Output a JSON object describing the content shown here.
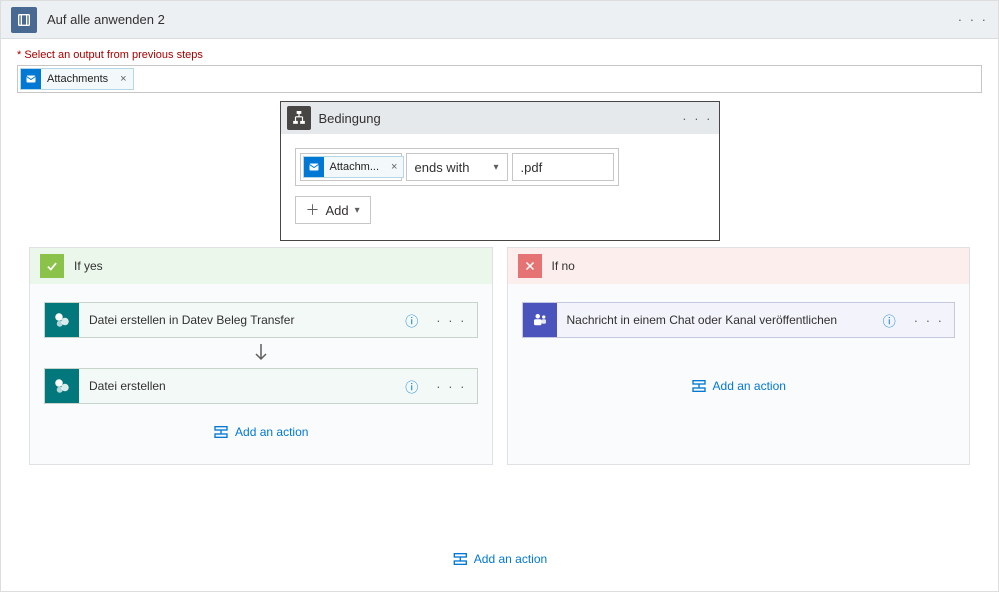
{
  "loop": {
    "title": "Auf alle anwenden 2"
  },
  "select_output": {
    "label": "Select an output from previous steps",
    "chip_text": "Attachments"
  },
  "condition": {
    "title": "Bedingung",
    "value1_chip": "Attachm...",
    "operator": "ends with",
    "value2": ".pdf",
    "add_label": "Add"
  },
  "branches": {
    "yes": {
      "label": "If yes",
      "actions": [
        {
          "title": "Datei erstellen in Datev Beleg Transfer"
        },
        {
          "title": "Datei erstellen"
        }
      ],
      "add_action": "Add an action"
    },
    "no": {
      "label": "If no",
      "actions": [
        {
          "title": "Nachricht in einem Chat oder Kanal veröffentlichen"
        }
      ],
      "add_action": "Add an action"
    }
  },
  "footer": {
    "add_action": "Add an action"
  }
}
